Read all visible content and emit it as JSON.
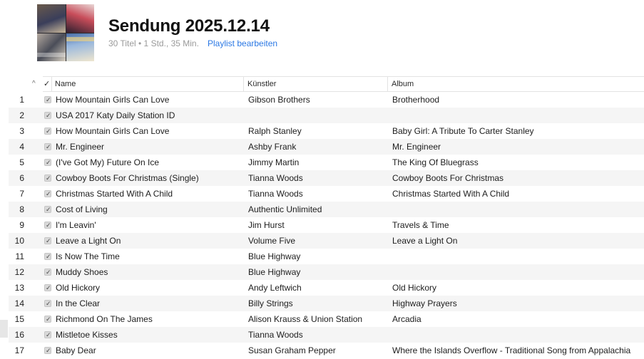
{
  "playlist": {
    "title": "Sendung 2025.12.14",
    "meta": "30 Titel • 1 Std., 35 Min.",
    "edit_label": "Playlist bearbeiten"
  },
  "columns": {
    "sort_indicator": "^",
    "check": "✓",
    "name": "Name",
    "artist": "Künstler",
    "album": "Album"
  },
  "tracks": [
    {
      "num": "1",
      "name": "How Mountain Girls Can Love",
      "artist": "Gibson Brothers",
      "album": "Brotherhood"
    },
    {
      "num": "2",
      "name": "USA 2017 Katy Daily Station ID",
      "artist": "",
      "album": ""
    },
    {
      "num": "3",
      "name": "How Mountain Girls Can Love",
      "artist": "Ralph Stanley",
      "album": "Baby Girl: A Tribute To Carter Stanley"
    },
    {
      "num": "4",
      "name": "Mr. Engineer",
      "artist": "Ashby Frank",
      "album": "Mr. Engineer"
    },
    {
      "num": "5",
      "name": "(I've Got My) Future On Ice",
      "artist": "Jimmy Martin",
      "album": "The King Of Bluegrass"
    },
    {
      "num": "6",
      "name": "Cowboy Boots For Christmas (Single)",
      "artist": "Tianna Woods",
      "album": "Cowboy Boots For Christmas"
    },
    {
      "num": "7",
      "name": "Christmas Started With A Child",
      "artist": "Tianna Woods",
      "album": "Christmas Started With A Child"
    },
    {
      "num": "8",
      "name": "Cost of Living",
      "artist": "Authentic Unlimited",
      "album": ""
    },
    {
      "num": "9",
      "name": "I'm Leavin'",
      "artist": "Jim Hurst",
      "album": "Travels & Time"
    },
    {
      "num": "10",
      "name": "Leave a Light On",
      "artist": "Volume Five",
      "album": "Leave a Light On"
    },
    {
      "num": "11",
      "name": "Is Now The Time",
      "artist": "Blue Highway",
      "album": ""
    },
    {
      "num": "12",
      "name": "Muddy Shoes",
      "artist": "Blue Highway",
      "album": ""
    },
    {
      "num": "13",
      "name": "Old Hickory",
      "artist": "Andy Leftwich",
      "album": "Old Hickory"
    },
    {
      "num": "14",
      "name": "In the Clear",
      "artist": "Billy Strings",
      "album": "Highway Prayers"
    },
    {
      "num": "15",
      "name": "Richmond On The James",
      "artist": "Alison Krauss & Union Station",
      "album": "Arcadia"
    },
    {
      "num": "16",
      "name": "Mistletoe Kisses",
      "artist": "Tianna Woods",
      "album": ""
    },
    {
      "num": "17",
      "name": "Baby Dear",
      "artist": "Susan Graham Pepper",
      "album": "Where the Islands Overflow - Traditional Song from Appalachia"
    }
  ]
}
